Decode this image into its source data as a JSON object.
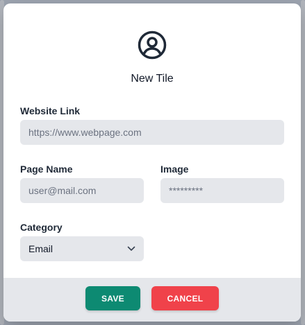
{
  "modal": {
    "title": "New Tile",
    "icon": "user-circle-icon"
  },
  "form": {
    "website_link": {
      "label": "Website Link",
      "placeholder": "https://www.webpage.com"
    },
    "page_name": {
      "label": "Page Name",
      "placeholder": "user@mail.com"
    },
    "image": {
      "label": "Image",
      "placeholder": "*********"
    },
    "category": {
      "label": "Category",
      "selected": "Email",
      "icon": "chevron-down-icon"
    }
  },
  "footer": {
    "save_label": "SAVE",
    "cancel_label": "CANCEL"
  },
  "colors": {
    "save": "#0d8a72",
    "cancel": "#f0424a",
    "field_bg": "#e5e7eb",
    "footer_bg": "#e5e7eb"
  }
}
